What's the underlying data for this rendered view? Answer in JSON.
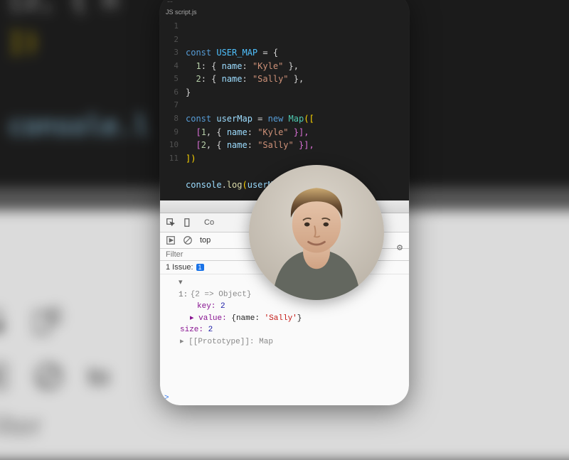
{
  "background": {
    "code_fragment_1": "[2, { n",
    "code_fragment_2": "])",
    "code_fragment_3": "console.l",
    "toolbar_top": "to",
    "filter_label": "Filter"
  },
  "editor": {
    "title_hint": "⋯",
    "tab_label": "JS script.js",
    "code": {
      "l1a": "const",
      "l1b": "USER_MAP",
      "l1c": " = {",
      "l2a": "  ",
      "l2b": "1",
      "l2c": ": { ",
      "l2d": "name",
      "l2e": ": ",
      "l2f": "\"Kyle\"",
      "l2g": " },",
      "l3a": "  ",
      "l3b": "2",
      "l3c": ": { ",
      "l3d": "name",
      "l3e": ": ",
      "l3f": "\"Sally\"",
      "l3g": " },",
      "l4": "}",
      "l6a": "const",
      "l6b": "userMap",
      "l6c": " = ",
      "l6d": "new",
      "l6e": " ",
      "l6f": "Map",
      "l6g": "([",
      "l7a": "  [",
      "l7b": "1",
      "l7c": ", { ",
      "l7d": "name",
      "l7e": ": ",
      "l7f": "\"Kyle\"",
      "l7g": " }],",
      "l8a": "  [",
      "l8b": "2",
      "l8c": ", { ",
      "l8d": "name",
      "l8e": ": ",
      "l8f": "\"Sally\"",
      "l8g": " }],",
      "l9": "])",
      "l11a": "console",
      "l11b": ".",
      "l11c": "log",
      "l11d": "(",
      "l11e": "userMap",
      "l11f": ")"
    }
  },
  "devtools": {
    "inspect_tab": "⟟",
    "console_tab": "Co",
    "context": "top",
    "filter_placeholder": "Filter",
    "issues_label": "1 Issue:",
    "issues_count": "1",
    "output": {
      "row1_pre": "▾ 1:",
      "row1_val": "{2 => Object}",
      "row2_key": "key:",
      "row2_val": "2",
      "row3_key": "▸ value:",
      "row3_val": "{name: 'Sally'}",
      "row4_key": "size:",
      "row4_val": "2",
      "row5": "▸ [[Prototype]]: Map"
    },
    "prompt": ">"
  },
  "icons": {
    "inspect": "inspect-icon",
    "device": "device-icon",
    "play": "play-icon",
    "clear": "clear-icon",
    "settings": "gear-icon"
  }
}
